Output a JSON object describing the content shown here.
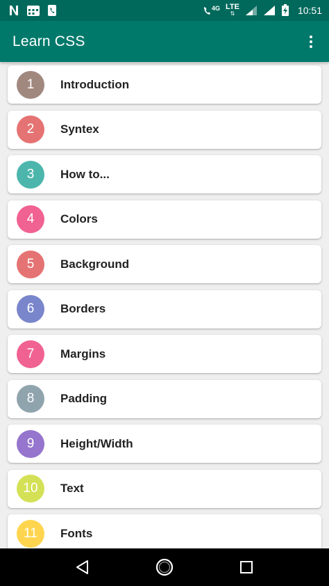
{
  "status_bar": {
    "time": "10:51",
    "network_4g": "4G",
    "network_lte": "LTE",
    "left_icons": [
      "netflix-n-icon",
      "calendar-notification-icon",
      "phone-notification-icon"
    ],
    "right_icons": [
      "wifi-calling-icon",
      "lte-icon",
      "signal-icon",
      "signal-icon",
      "battery-charging-icon"
    ]
  },
  "app_bar": {
    "title": "Learn CSS",
    "menu_icon": "overflow-menu-icon"
  },
  "topics": [
    {
      "number": "1",
      "label": "Introduction",
      "color": "#a1887f"
    },
    {
      "number": "2",
      "label": "Syntex",
      "color": "#e57373"
    },
    {
      "number": "3",
      "label": "How to...",
      "color": "#4db6ac"
    },
    {
      "number": "4",
      "label": "Colors",
      "color": "#f06292"
    },
    {
      "number": "5",
      "label": "Background",
      "color": "#e57373"
    },
    {
      "number": "6",
      "label": "Borders",
      "color": "#7986cb"
    },
    {
      "number": "7",
      "label": "Margins",
      "color": "#f06292"
    },
    {
      "number": "8",
      "label": "Padding",
      "color": "#90a4ae"
    },
    {
      "number": "9",
      "label": "Height/Width",
      "color": "#9575cd"
    },
    {
      "number": "10",
      "label": "Text",
      "color": "#d4e157"
    },
    {
      "number": "11",
      "label": "Fonts",
      "color": "#ffd54f"
    }
  ],
  "nav_bar": {
    "back_icon": "back-triangle-icon",
    "home_icon": "home-circle-icon",
    "recents_icon": "recents-square-icon"
  },
  "colors": {
    "status_bar": "#00695c",
    "app_bar": "#00796b",
    "background": "#efefef"
  }
}
